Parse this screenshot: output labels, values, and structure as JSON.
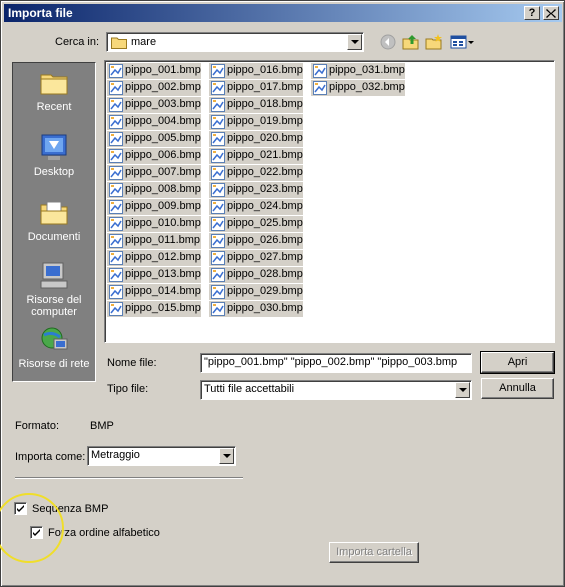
{
  "window": {
    "title": "Importa file",
    "help_button": "?",
    "close_button": "X"
  },
  "look_in": {
    "label": "Cerca in:",
    "value": "mare",
    "icon": "folder-icon"
  },
  "toolbar": {
    "icons": [
      "back-icon",
      "up-folder-icon",
      "new-folder-icon",
      "view-menu-icon"
    ]
  },
  "places": [
    {
      "label": "Recent",
      "icon": "recent-folder-icon"
    },
    {
      "label": "Desktop",
      "icon": "desktop-icon"
    },
    {
      "label": "Documenti",
      "icon": "documents-icon"
    },
    {
      "label": "Risorse del computer",
      "icon": "my-computer-icon"
    },
    {
      "label": "Risorse di rete",
      "icon": "network-icon"
    }
  ],
  "files": [
    "pippo_001.bmp",
    "pippo_002.bmp",
    "pippo_003.bmp",
    "pippo_004.bmp",
    "pippo_005.bmp",
    "pippo_006.bmp",
    "pippo_007.bmp",
    "pippo_008.bmp",
    "pippo_009.bmp",
    "pippo_010.bmp",
    "pippo_011.bmp",
    "pippo_012.bmp",
    "pippo_013.bmp",
    "pippo_014.bmp",
    "pippo_015.bmp",
    "pippo_016.bmp",
    "pippo_017.bmp",
    "pippo_018.bmp",
    "pippo_019.bmp",
    "pippo_020.bmp",
    "pippo_021.bmp",
    "pippo_022.bmp",
    "pippo_023.bmp",
    "pippo_024.bmp",
    "pippo_025.bmp",
    "pippo_026.bmp",
    "pippo_027.bmp",
    "pippo_028.bmp",
    "pippo_029.bmp",
    "pippo_030.bmp",
    "pippo_031.bmp",
    "pippo_032.bmp"
  ],
  "filename": {
    "label": "Nome file:",
    "value": "\"pippo_001.bmp\" \"pippo_002.bmp\" \"pippo_003.bmp"
  },
  "filetype": {
    "label": "Tipo file:",
    "value": "Tutti file accettabili"
  },
  "buttons": {
    "open": "Apri",
    "cancel": "Annulla",
    "import_folder": "Importa cartella"
  },
  "format": {
    "label": "Formato:",
    "value": "BMP"
  },
  "import_as": {
    "label": "Importa come:",
    "value": "Metraggio"
  },
  "options": {
    "bmp_sequence": {
      "label": "Sequenza BMP",
      "checked": true
    },
    "force_alpha": {
      "label": "Forza ordine alfabetico",
      "checked": true
    }
  },
  "colors": {
    "title_start": "#0a246a",
    "title_end": "#a6caf0",
    "face": "#d4d0c8",
    "highlight_circle": "#f0de2a"
  }
}
